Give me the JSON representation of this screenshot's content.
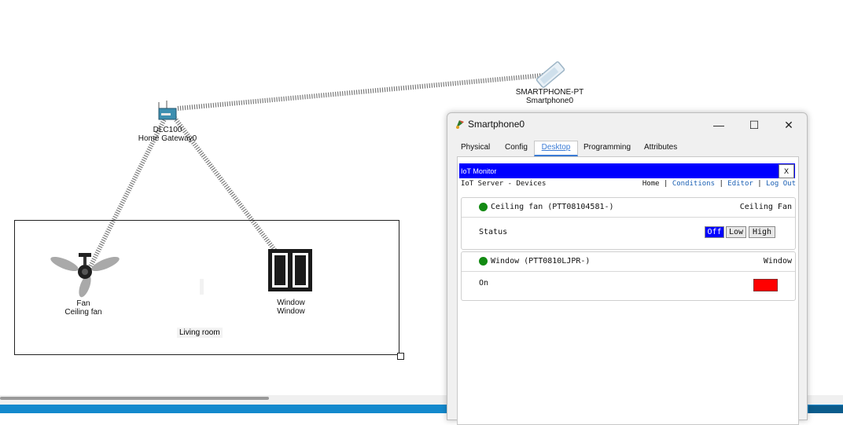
{
  "canvas": {
    "gateway": {
      "line1": "DLC100",
      "line2": "Home Gateway0"
    },
    "smartphone": {
      "line1": "SMARTPHONE-PT",
      "line2": "Smartphone0"
    },
    "fan": {
      "line1": "Fan",
      "line2": "Ceiling fan"
    },
    "window_device": {
      "line1": "Window",
      "line2": "Window"
    },
    "room_label": "Living room"
  },
  "dialog": {
    "title": "Smartphone0",
    "title_buttons": {
      "minimize": "—",
      "maximize": "☐",
      "close": "✕"
    },
    "tabs": [
      "Physical",
      "Config",
      "Desktop",
      "Programming",
      "Attributes"
    ],
    "active_tab": "Desktop",
    "iot_monitor": {
      "title": "IoT Monitor",
      "close_label": "X",
      "server_label": "IoT Server - Devices",
      "nav": [
        "Home",
        "Conditions",
        "Editor",
        "Log Out"
      ],
      "nav_separator": "|"
    },
    "devices": [
      {
        "name": "Ceiling fan (PTT08104581-)",
        "type": "Ceiling Fan",
        "status_color": "#138a13",
        "row_label": "Status",
        "options": [
          "Off",
          "Low",
          "High"
        ],
        "selected": "Off"
      },
      {
        "name": "Window (PTT0810LJPR-)",
        "type": "Window",
        "status_color": "#138a13",
        "row_label": "On",
        "indicator_color": "#ff0000"
      }
    ]
  },
  "colors": {
    "iot_bar": "#0000ff",
    "active_tab": "#3a7bd5",
    "taskbar": "#1389cd"
  }
}
